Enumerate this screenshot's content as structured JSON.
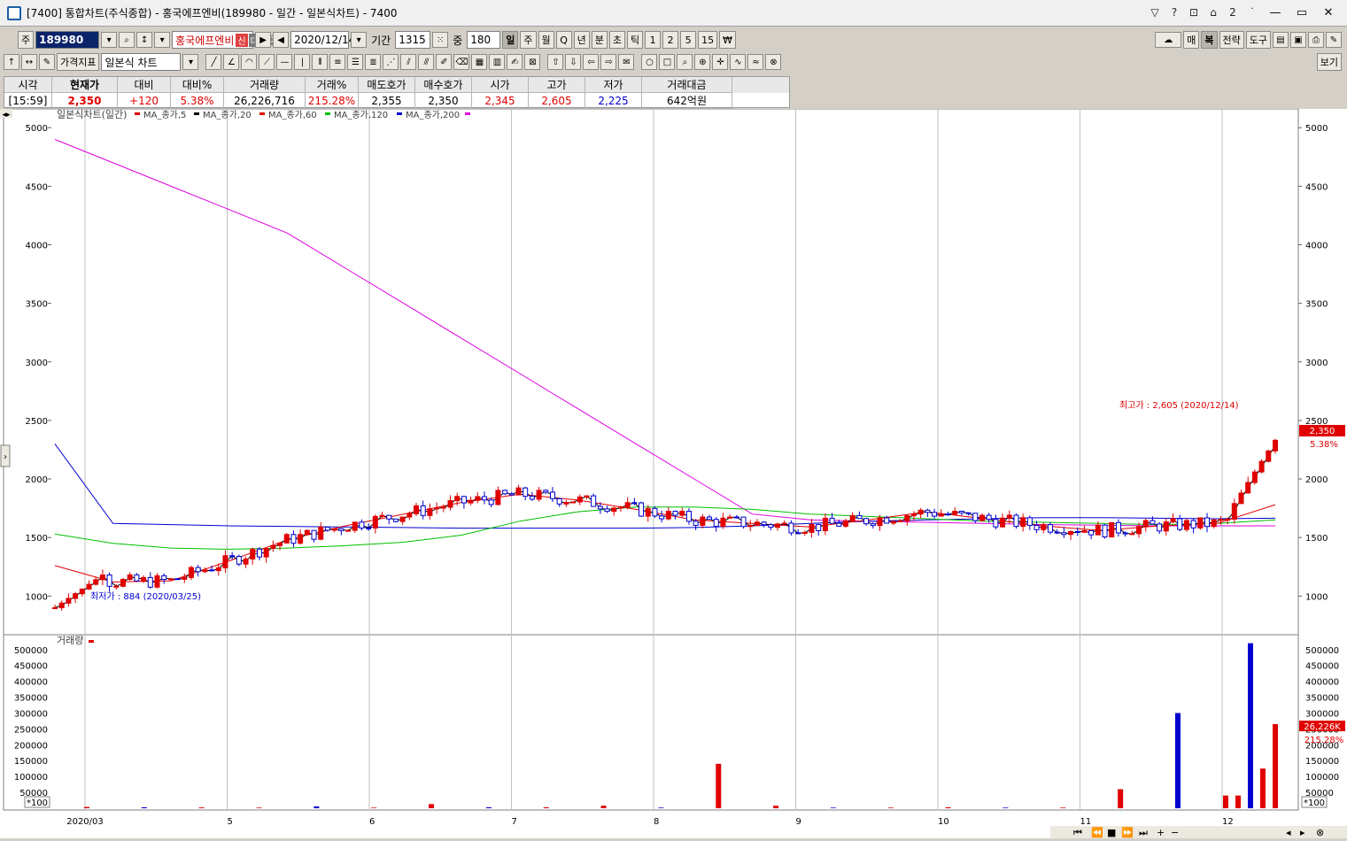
{
  "window": {
    "title": "[7400] 통합차트(주식종합) - 홍국에프엔비(189980 - 일간 - 일본식차트) - 7400"
  },
  "toolbar1": {
    "code_prefix": "주",
    "code": "189980",
    "stock_name": "홍국에프엔비",
    "tag1": "신",
    "tag2": "대",
    "tag3": "40",
    "date": "2020/12/14",
    "period_label": "기간",
    "period_value": "1315",
    "count_label": "중",
    "count_value": "180",
    "timeframes": [
      "일",
      "주",
      "월",
      "Q",
      "년",
      "분",
      "초",
      "틱",
      "1",
      "2",
      "5",
      "15",
      "₩"
    ],
    "right_buttons": [
      "매",
      "복",
      "전략",
      "도구"
    ]
  },
  "toolbar2": {
    "indicator_label": "가격지표",
    "chart_type": "일본식 차트",
    "view_button": "보기"
  },
  "quote": {
    "headers": [
      "시각",
      "현재가",
      "대비",
      "대비%",
      "거래량",
      "거래%",
      "매도호가",
      "매수호가",
      "시가",
      "고가",
      "저가",
      "거래대금"
    ],
    "values": [
      "[15:59]",
      "2,350",
      "+120",
      "5.38%",
      "26,226,716",
      "215.28%",
      "2,355",
      "2,350",
      "2,345",
      "2,605",
      "2,225",
      "642억원"
    ]
  },
  "chart": {
    "legend": [
      "일본식차트(일간)",
      "MA_종가,5",
      "MA_종가,20",
      "MA_종가,60",
      "MA_종가,120",
      "MA_종가,200"
    ],
    "ma_colors": [
      "#e00000",
      "#000000",
      "#e00000",
      "#00c000",
      "#0000d0",
      "#e000e0"
    ],
    "high_note": "최고가 : 2,605 (2020/12/14)",
    "low_note": "최저가 : 884 (2020/03/25)",
    "price_tag": "2,350",
    "pct_tag": "5.38%",
    "volume_legend": "거래량",
    "volume_tag": "26,226K",
    "volume_pct_tag": "215.28%",
    "unit_label": "*100"
  },
  "chart_data": [
    {
      "type": "line",
      "y_ticks": [
        1000,
        1500,
        2000,
        2500,
        3000,
        3500,
        4000,
        4500,
        5000
      ],
      "ylim": [
        700,
        5100
      ],
      "x_tick_labels": [
        "2020/03",
        "5",
        "6",
        "7",
        "8",
        "9",
        "10",
        "11",
        "12"
      ],
      "series": [
        {
          "name": "MA_종가,200",
          "values": [
            4900,
            4700,
            4500,
            4300,
            4100,
            3800,
            3500,
            3200,
            2900,
            2600,
            2300,
            2000,
            1700,
            1650,
            1640,
            1630,
            1620,
            1610,
            1605,
            1600,
            1600,
            1600
          ]
        },
        {
          "name": "MA_종가,120",
          "values": [
            2300,
            1620,
            1610,
            1600,
            1595,
            1590,
            1585,
            1580,
            1580,
            1580,
            1580,
            1585,
            1600,
            1620,
            1640,
            1650,
            1660,
            1670,
            1670,
            1665,
            1660,
            1665
          ]
        },
        {
          "name": "MA_종가,60",
          "values": [
            1530,
            1450,
            1410,
            1400,
            1410,
            1430,
            1460,
            1520,
            1640,
            1720,
            1760,
            1760,
            1740,
            1700,
            1680,
            1660,
            1640,
            1630,
            1620,
            1610,
            1620,
            1650
          ]
        },
        {
          "name": "MA_종가,20",
          "values": [
            1260,
            1120,
            1130,
            1300,
            1480,
            1600,
            1700,
            1800,
            1870,
            1820,
            1740,
            1650,
            1620,
            1590,
            1650,
            1720,
            1660,
            1600,
            1560,
            1600,
            1620,
            1780
          ]
        }
      ]
    },
    {
      "type": "bar",
      "y_ticks": [
        50000,
        100000,
        150000,
        200000,
        250000,
        300000,
        350000,
        400000,
        450000,
        500000
      ],
      "ylim": [
        0,
        530000
      ],
      "values": [
        4000,
        3000,
        2500,
        2000,
        6000,
        2000,
        13000,
        3000,
        3000,
        8000,
        2000,
        140000,
        8000,
        2000,
        2000,
        3000,
        2000,
        2000,
        60000,
        300000,
        40000,
        40000,
        520000,
        125000,
        265000
      ]
    }
  ]
}
